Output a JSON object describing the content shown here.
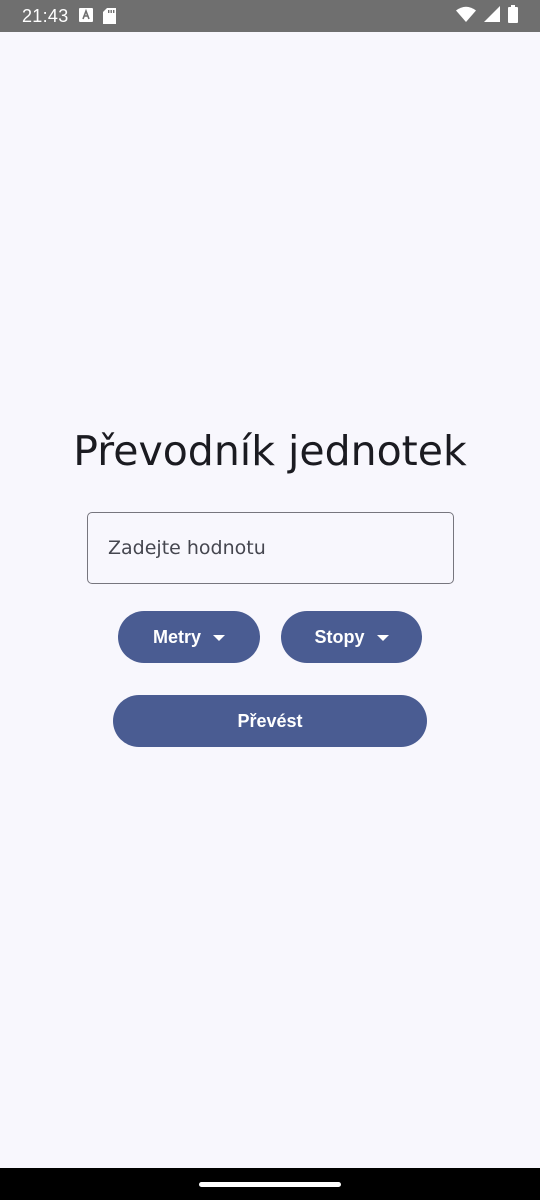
{
  "status_bar": {
    "time": "21:43",
    "icons": [
      "keyboard-a-icon",
      "sd-card-icon",
      "wifi-icon",
      "signal-icon",
      "battery-icon"
    ]
  },
  "app": {
    "title": "Převodník jednotek",
    "value_input": {
      "placeholder": "Zadejte hodnotu",
      "value": ""
    },
    "from_unit": {
      "selected": "Metry"
    },
    "to_unit": {
      "selected": "Stopy"
    },
    "convert_label": "Převést"
  },
  "colors": {
    "primary": "#4a5c92",
    "background": "#f8f7fd",
    "status_bar": "#6f6f6f",
    "title_text": "#1b1b21"
  }
}
